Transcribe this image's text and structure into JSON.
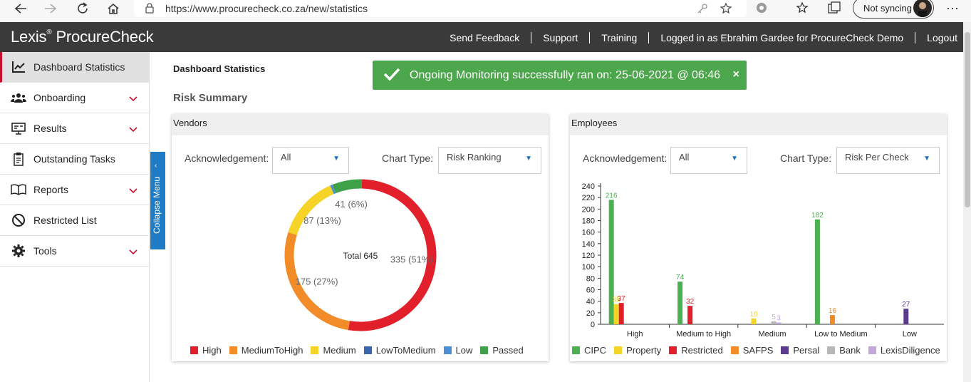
{
  "browser": {
    "url": "https://www.procurecheck.co.za/new/statistics",
    "sync_label": "Not syncing"
  },
  "header": {
    "brand": "Lexis",
    "brand_reg": "®",
    "brand_product": "ProcureCheck",
    "links": [
      "Send Feedback",
      "Support",
      "Training",
      "Logged in as Ebrahim Gardee for ProcureCheck Demo",
      "Logout"
    ]
  },
  "sidebar": {
    "items": [
      {
        "label": "Dashboard Statistics",
        "icon": "chart-line-icon",
        "expandable": false,
        "active": true
      },
      {
        "label": "Onboarding",
        "icon": "users-icon",
        "expandable": true,
        "active": false
      },
      {
        "label": "Results",
        "icon": "presentation-icon",
        "expandable": true,
        "active": false
      },
      {
        "label": "Outstanding Tasks",
        "icon": "clipboard-icon",
        "expandable": false,
        "active": false
      },
      {
        "label": "Reports",
        "icon": "book-icon",
        "expandable": true,
        "active": false
      },
      {
        "label": "Restricted List",
        "icon": "ban-icon",
        "expandable": false,
        "active": false
      },
      {
        "label": "Tools",
        "icon": "gear-icon",
        "expandable": true,
        "active": false
      }
    ],
    "collapse_label": "Collapse Menu"
  },
  "main": {
    "breadcrumb": "Dashboard Statistics",
    "section_title": "Risk Summary"
  },
  "toast": {
    "message": "Ongoing Monitoring successfully ran on: 25-06-2021 @ 06:46",
    "close": "×"
  },
  "vendors": {
    "title": "Vendors",
    "ack_label": "Acknowledgement:",
    "ack_value": "All",
    "chart_type_label": "Chart Type:",
    "chart_type_value": "Risk Ranking"
  },
  "employees": {
    "title": "Employees",
    "ack_label": "Acknowledgement:",
    "ack_value": "All",
    "chart_type_label": "Chart Type:",
    "chart_type_value": "Risk Per Check"
  },
  "colors": {
    "high": "#e2202c",
    "medium_to_high": "#f28c28",
    "medium": "#f5d327",
    "low_to_medium": "#3a66b0",
    "low": "#4a8fd8",
    "passed": "#3fa14a",
    "cipc": "#4caf50",
    "property": "#f5d327",
    "restricted": "#e2202c",
    "safps": "#f28c28",
    "persal": "#5a3b8c",
    "bank": "#b7b7b7",
    "lexisdiligence": "#c3a6dc"
  },
  "chart_data": [
    {
      "type": "pie",
      "variant": "donut",
      "center_label": "Total 645",
      "labels": [
        "High",
        "MediumToHigh",
        "Medium",
        "LowToMedium",
        "Low",
        "Passed"
      ],
      "values": [
        335,
        175,
        87,
        0,
        3,
        41
      ],
      "slice_labels": [
        "335 (51%)",
        "175 (27%)",
        "87 (13%)",
        "",
        "",
        "41 (6%)"
      ],
      "colors": [
        "#e2202c",
        "#f28c28",
        "#f5d327",
        "#3a66b0",
        "#4a8fd8",
        "#3fa14a"
      ],
      "legend_position": "bottom"
    },
    {
      "type": "bar",
      "categories": [
        "High",
        "Medium to High",
        "Medium",
        "Low to Medium",
        "Low"
      ],
      "series": [
        {
          "name": "CIPC",
          "color": "#4caf50",
          "values": [
            216,
            74,
            0,
            182,
            0
          ]
        },
        {
          "name": "Property",
          "color": "#f5d327",
          "values": [
            35,
            0,
            10,
            0,
            0
          ]
        },
        {
          "name": "Restricted",
          "color": "#e2202c",
          "values": [
            37,
            32,
            0,
            0,
            0
          ]
        },
        {
          "name": "SAFPS",
          "color": "#f28c28",
          "values": [
            0,
            0,
            0,
            16,
            0
          ]
        },
        {
          "name": "Persal",
          "color": "#5a3b8c",
          "values": [
            0,
            0,
            0,
            0,
            27
          ]
        },
        {
          "name": "Bank",
          "color": "#b7b7b7",
          "values": [
            0,
            0,
            5,
            0,
            0
          ]
        },
        {
          "name": "LexisDiligence",
          "color": "#c3a6dc",
          "values": [
            0,
            0,
            3,
            0,
            0
          ]
        }
      ],
      "ylim": [
        0,
        240
      ],
      "yticks": [
        0,
        20,
        40,
        60,
        80,
        100,
        120,
        140,
        160,
        180,
        200,
        220,
        240
      ],
      "legend_position": "bottom"
    }
  ]
}
